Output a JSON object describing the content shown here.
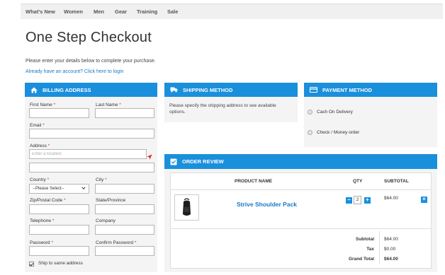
{
  "nav": {
    "items": [
      "What's New",
      "Women",
      "Men",
      "Gear",
      "Training",
      "Sale"
    ]
  },
  "page": {
    "title": "One Step Checkout",
    "intro": "Please enter your details below to complete your purchase.",
    "login_link": "Already have an account? Click here to login"
  },
  "billing": {
    "title": "BILLING ADDRESS",
    "first_name": {
      "label": "First Name",
      "value": ""
    },
    "last_name": {
      "label": "Last Name",
      "value": ""
    },
    "email": {
      "label": "Email",
      "value": ""
    },
    "address": {
      "label": "Address",
      "placeholder": "Enter a location",
      "value": "",
      "line2": ""
    },
    "country": {
      "label": "Country",
      "selected": "--Please Select--"
    },
    "city": {
      "label": "City",
      "value": ""
    },
    "zip": {
      "label": "Zip/Postal Code",
      "value": ""
    },
    "state": {
      "label": "State/Province",
      "value": ""
    },
    "telephone": {
      "label": "Telephone",
      "value": ""
    },
    "company": {
      "label": "Company",
      "value": ""
    },
    "password": {
      "label": "Password",
      "value": ""
    },
    "confirm_password": {
      "label": "Confirm Password",
      "value": ""
    },
    "required_mark": "*",
    "ship_same": {
      "label": "Ship to same address",
      "checked": true
    }
  },
  "shipping": {
    "title": "SHIPPING METHOD",
    "message": "Please specify the shipping address to see available options."
  },
  "payment": {
    "title": "PAYMENT METHOD",
    "options": [
      "Cash On Delivery",
      "Check / Money order"
    ]
  },
  "review": {
    "title": "ORDER REVIEW",
    "columns": {
      "product": "PRODUCT NAME",
      "qty": "QTY",
      "subtotal": "SUBTOTAL"
    },
    "item": {
      "name": "Strive Shoulder Pack",
      "qty": "2",
      "subtotal": "$64.00"
    },
    "totals": {
      "subtotal_label": "Subtotal",
      "subtotal": "$64.00",
      "tax_label": "Tax",
      "tax": "$0.00",
      "grand_label": "Grand Total",
      "grand": "$64.00"
    }
  },
  "icons": {
    "billing": "home-icon",
    "shipping": "truck-icon",
    "payment": "credit-card-icon",
    "review": "checkbox-icon",
    "locate": "location-arrow-icon"
  },
  "colors": {
    "accent": "#1a8fdc",
    "link": "#1979c3",
    "required": "#e02b27"
  }
}
